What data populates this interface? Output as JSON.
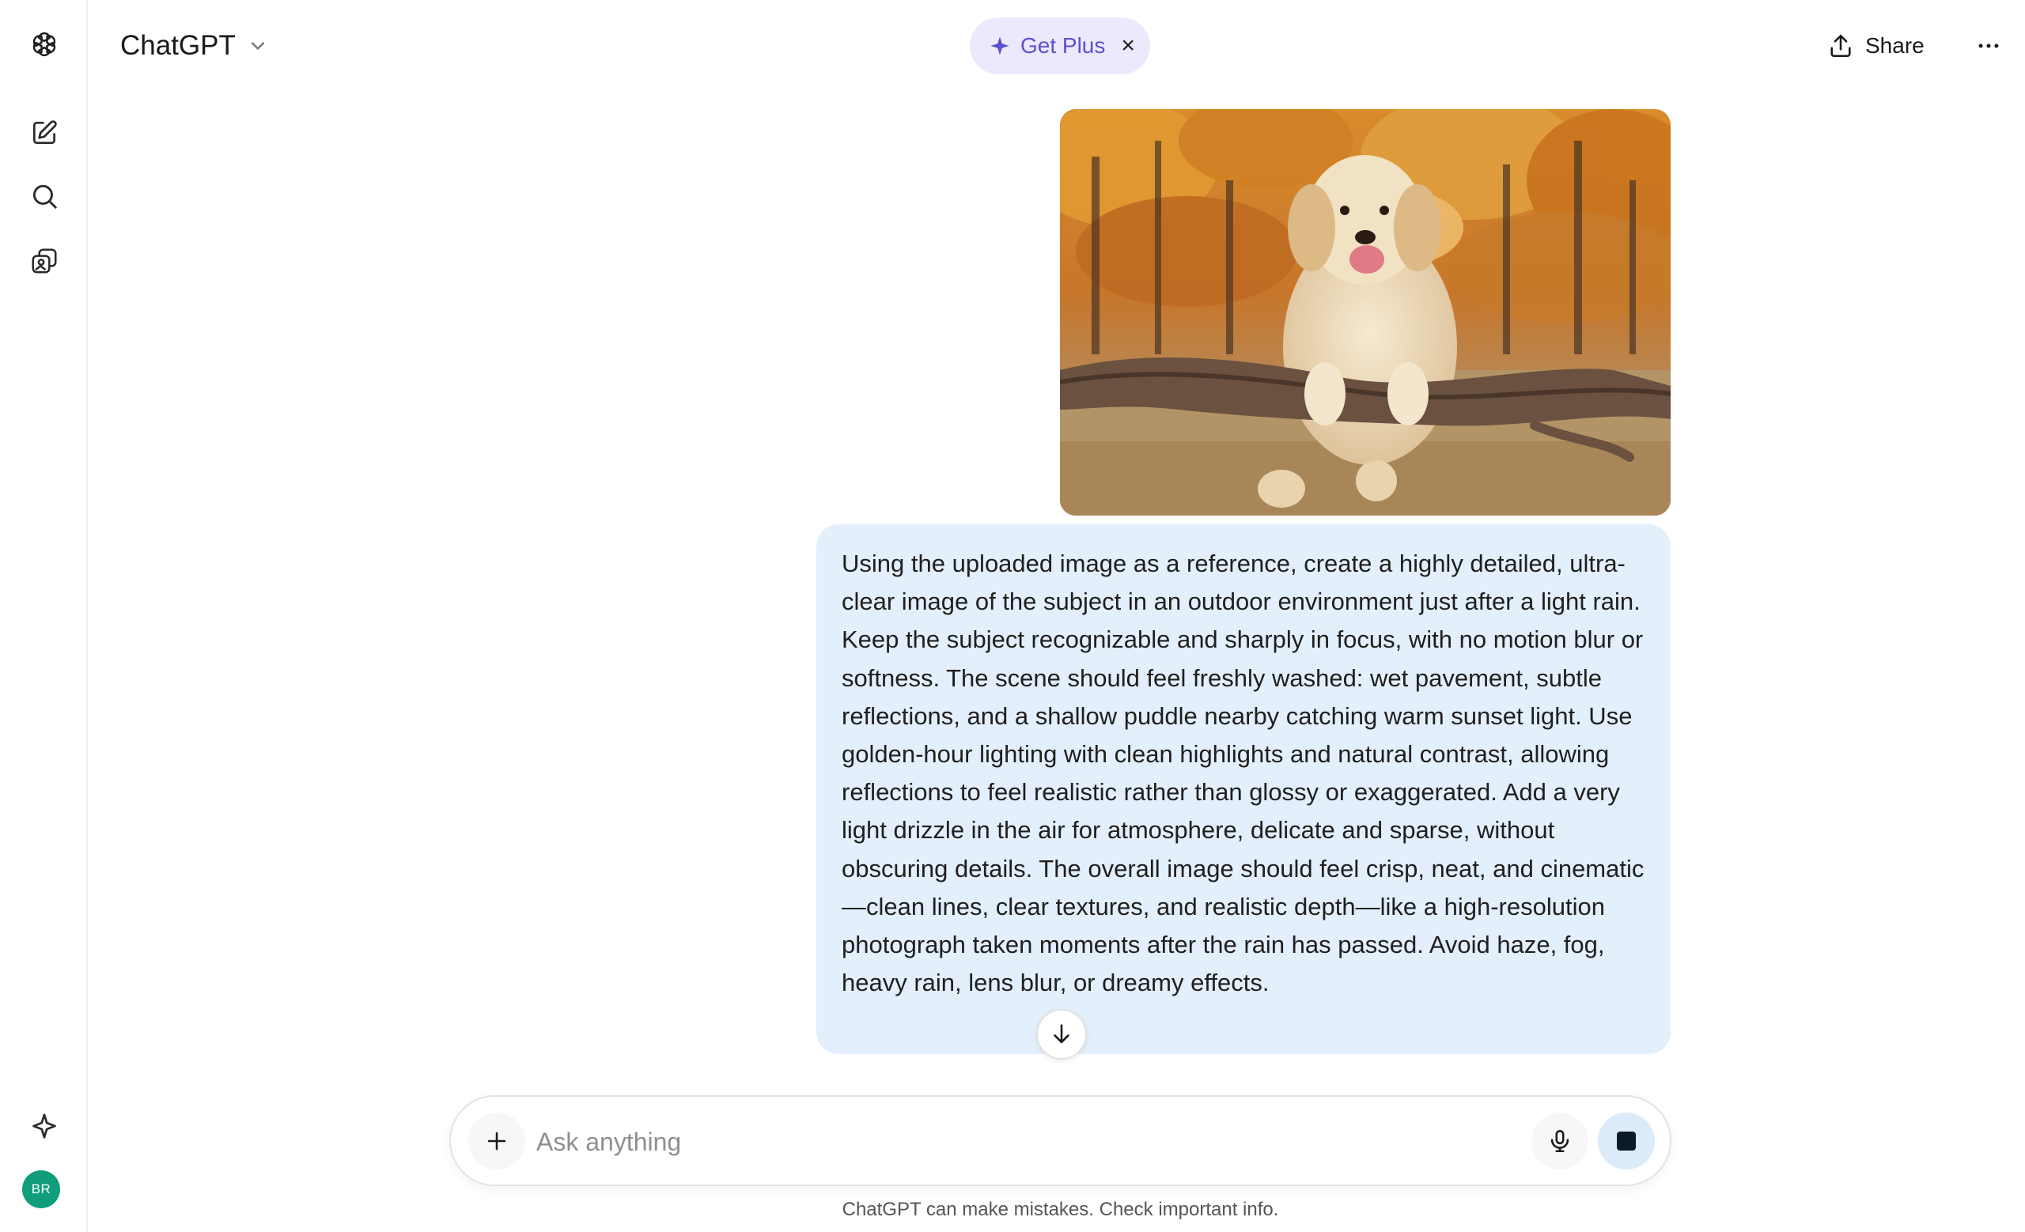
{
  "header": {
    "model_name": "ChatGPT",
    "get_plus_label": "Get Plus",
    "get_plus_close": "×",
    "share_label": "Share"
  },
  "sidebar": {
    "avatar_initials": "BR",
    "items": [
      {
        "icon": "openai-logo-icon"
      },
      {
        "icon": "new-chat-icon"
      },
      {
        "icon": "search-icon"
      },
      {
        "icon": "library-icon"
      },
      {
        "icon": "sparkle-icon"
      }
    ]
  },
  "conversation": {
    "attachment": {
      "kind": "photo",
      "subject": "golden retriever"
    },
    "user_message": "Using the uploaded image as a reference, create a highly detailed, ultra-clear image of the subject in an outdoor environment just after a light rain. Keep the subject recognizable and sharply in focus, with no motion blur or softness. The scene should feel freshly washed: wet pavement, subtle reflections, and a shallow puddle nearby catching warm sunset light. Use golden-hour lighting with clean highlights and natural contrast, allowing reflections to feel realistic rather than glossy or exaggerated. Add a very light drizzle in the air for atmosphere, delicate and sparse, without obscuring details. The overall image should feel crisp, neat, and cinematic—clean lines, clear textures, and realistic depth—like a high-resolution photograph taken moments after the rain has passed. Avoid haze, fog, heavy rain, lens blur, or dreamy effects."
  },
  "composer": {
    "placeholder": "Ask anything",
    "value": ""
  },
  "footer": {
    "disclaimer": "ChatGPT can make mistakes. Check important info."
  },
  "colors": {
    "bubble": "#e3effb",
    "get_plus_bg": "#ebe9fb",
    "get_plus_text": "#5b4fd1",
    "avatar": "#0f9d7a",
    "stop_btn_bg": "#dcebfa"
  }
}
